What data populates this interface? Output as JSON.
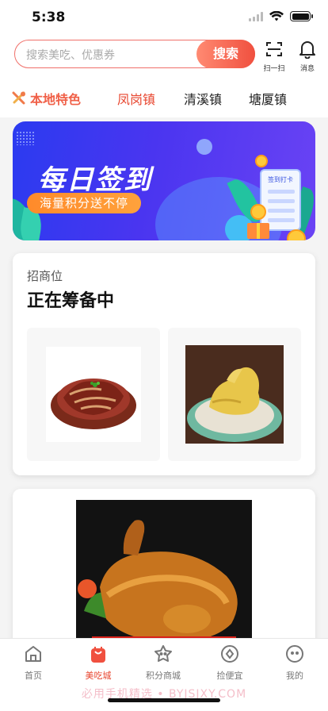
{
  "status": {
    "time": "5:38"
  },
  "search": {
    "placeholder": "搜索美吃、优惠券",
    "button": "搜索"
  },
  "header_icons": {
    "scan_label": "扫一扫",
    "message_label": "消息"
  },
  "categories": {
    "special": "本地特色",
    "items": [
      "凤岗镇",
      "清溪镇",
      "塘厦镇"
    ],
    "active_index": 0,
    "active_color": "#e8462f"
  },
  "banner": {
    "title": "每日签到",
    "subtitle": "海量积分送不停",
    "phone_label": "签到打卡"
  },
  "merchant": {
    "label": "招商位",
    "title": "正在筹备中"
  },
  "tabbar": {
    "items": [
      {
        "label": "首页",
        "icon": "home-icon"
      },
      {
        "label": "美吃城",
        "icon": "shopping-bag-icon"
      },
      {
        "label": "积分商城",
        "icon": "star-bag-icon"
      },
      {
        "label": "捡便宜",
        "icon": "diamond-coupon-icon"
      },
      {
        "label": "我的",
        "icon": "profile-face-icon"
      }
    ],
    "active_index": 1
  },
  "watermark": "必用手机精选 • BYJSJXY.COM",
  "colors": {
    "accent": "#e8462f",
    "banner_blue": "#2b3bf0",
    "search_border": "#f0706a"
  }
}
